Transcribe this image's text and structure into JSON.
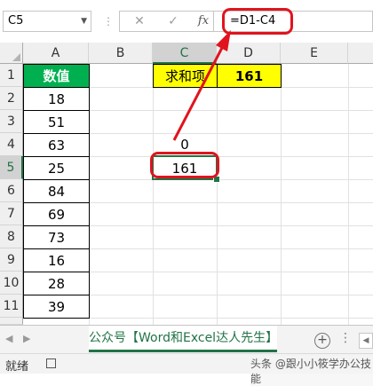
{
  "formula_bar": {
    "name_box": "C5",
    "separator": "⋮",
    "cancel_icon": "✕",
    "enter_icon": "✓",
    "fx_label": "fx",
    "formula": "=D1-C4"
  },
  "columns": [
    "A",
    "B",
    "C",
    "D",
    "E"
  ],
  "rows": [
    "1",
    "2",
    "3",
    "4",
    "5",
    "6",
    "7",
    "8",
    "9",
    "10",
    "11"
  ],
  "column_a": {
    "header": "数值",
    "values": [
      "18",
      "51",
      "63",
      "25",
      "84",
      "69",
      "73",
      "16",
      "28",
      "39"
    ]
  },
  "summary": {
    "label": "求和项",
    "value": "161"
  },
  "cells": {
    "c4": "0",
    "c5": "161"
  },
  "sheet_tabs": [
    "公众号【Word和Excel达人先生】"
  ],
  "status": {
    "ready": "就绪",
    "watermark": "头条 @跟小小筱学办公技能"
  },
  "colors": {
    "accent": "#217346",
    "header_green": "#00b050",
    "highlight_yellow": "#ffff00",
    "annotation_red": "#e0141e"
  },
  "icons": {
    "name_box_dropdown": "chevron-down-icon",
    "add_sheet": "plus-circle-icon",
    "nav_prev": "triangle-left-icon",
    "nav_next": "triangle-right-icon"
  }
}
